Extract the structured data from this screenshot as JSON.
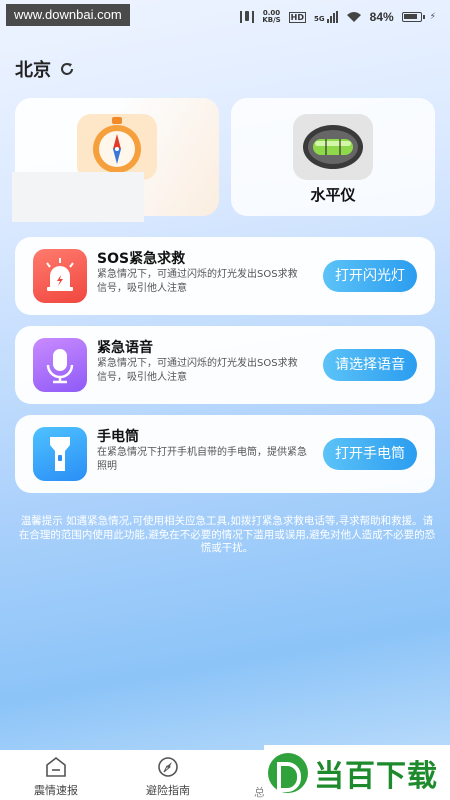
{
  "status_bar": {
    "watermark": "www.downbai.com",
    "net_speed_value": "0.00",
    "net_speed_unit": "KB/S",
    "hd": "HD",
    "signal_type": "5G",
    "battery_percent": "84%"
  },
  "location": {
    "city": "北京"
  },
  "tools": [
    {
      "label": "",
      "icon": "compass-icon"
    },
    {
      "label": "水平仪",
      "icon": "spirit-level-icon"
    }
  ],
  "cards": [
    {
      "title": "SOS紧急求救",
      "desc": "紧急情况下，可通过闪烁的灯光发出SOS求救信号，吸引他人注意",
      "button": "打开闪光灯",
      "icon": "alarm-light-icon",
      "color": "#f0473e"
    },
    {
      "title": "紧急语音",
      "desc": "紧急情况下，可通过闪烁的灯光发出SOS求救信号，吸引他人注意",
      "button": "请选择语音",
      "icon": "microphone-icon",
      "color": "#8f5af7"
    },
    {
      "title": "手电筒",
      "desc": "在紧急情况下打开手机自带的手电筒，提供紧急照明",
      "button": "打开手电筒",
      "icon": "flashlight-icon",
      "color": "#2a8ef5"
    }
  ],
  "tip": "温馨提示 如遇紧急情况,可使用相关应急工具,如拨打紧急求救电话等,寻求帮助和救援。请在合理的范围内使用此功能,避免在不必要的情况下滥用或误用,避免对他人造成不必要的恐慌或干扰。",
  "tabs": [
    {
      "label": "震情速报",
      "icon": "home-icon"
    },
    {
      "label": "避险指南",
      "icon": "compass-icon"
    },
    {
      "label": "总",
      "icon": ""
    }
  ],
  "logo": {
    "text": "当百下载"
  }
}
